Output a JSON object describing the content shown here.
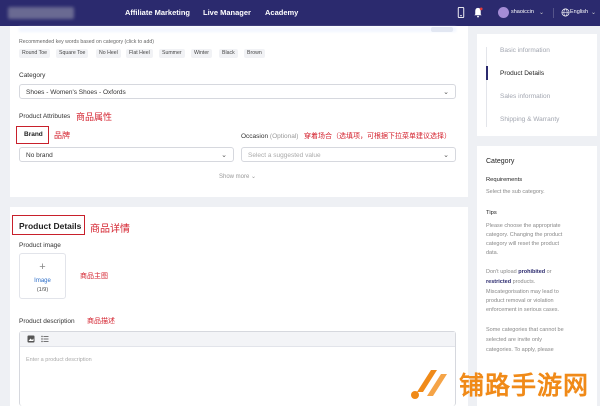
{
  "topbar": {
    "nav": [
      "Affiliate Marketing",
      "Live Manager",
      "Academy"
    ],
    "user": "shaoiccin",
    "language": "English"
  },
  "keywords": {
    "hint": "Recommended key words based on category (click to add)",
    "chips": [
      "Round Toe",
      "Square Toe",
      "No Heel",
      "Flat Heel",
      "Summer",
      "Winter",
      "Black",
      "Brown"
    ]
  },
  "category": {
    "label": "Category",
    "value": "Shoes - Women's Shoes - Oxfords"
  },
  "product_attributes": {
    "label": "Product Attributes",
    "annotation": "商品属性",
    "brand": {
      "label": "Brand",
      "annotation": "品牌",
      "value": "No brand"
    },
    "occasion": {
      "label": "Occasion",
      "optional": "(Optional)",
      "annotation": "穿着场合（选填项，可根据下拉菜单建议选择）",
      "placeholder": "Select a suggested value"
    },
    "show_more": "Show more"
  },
  "product_details": {
    "title": "Product Details",
    "annotation": "商品详情",
    "image_label": "Product image",
    "upload_label": "Image",
    "upload_count": "(1/9)",
    "image_annotation": "商品主图",
    "desc_label": "Product description",
    "desc_annotation": "商品描述",
    "desc_placeholder": "Enter a product description"
  },
  "side_nav": {
    "items": [
      "Basic information",
      "Product Details",
      "Sales information",
      "Shipping & Warranty"
    ],
    "active_index": 1
  },
  "tips_panel": {
    "title": "Category",
    "requirements_label": "Requirements",
    "requirements_text": "Select the sub category.",
    "tips_label": "Tips",
    "tip1": [
      "Please choose the appropriate",
      "category. Changing the product",
      "category will reset the product",
      "data."
    ],
    "tip2_pre": "Don't upload ",
    "tip2_prohibited": "prohibited",
    "tip2_mid": " or",
    "tip2_restricted": "restricted",
    "tip2_post": " products.",
    "tip2_rest": [
      "Miscategorisation may lead to",
      "product removal or violation",
      "enforcement in serious cases."
    ],
    "tip3": [
      "Some categories that cannot be",
      "selected are invite only",
      "categories. To apply, please"
    ]
  },
  "watermark": {
    "text": "铺路手游网"
  },
  "colors": {
    "topbar": "#2b2a6e",
    "annotation_red": "#d4232f",
    "link_blue": "#2d6fc9",
    "watermark_orange": "#f08a18"
  }
}
